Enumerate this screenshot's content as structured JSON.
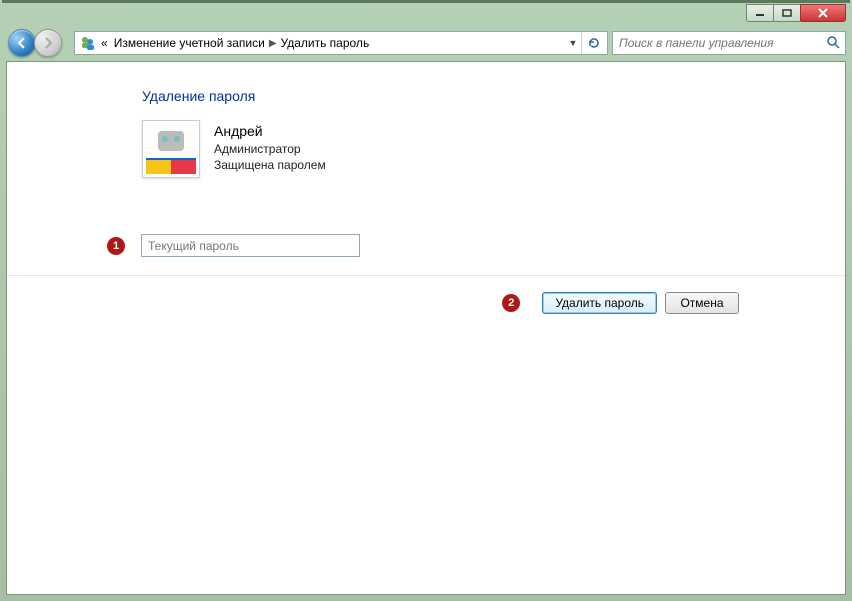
{
  "breadcrumb": {
    "prefix_icon": "users-icon",
    "overflow": "«",
    "items": [
      "Изменение учетной записи",
      "Удалить пароль"
    ]
  },
  "search": {
    "placeholder": "Поиск в панели управления"
  },
  "page": {
    "heading": "Удаление пароля"
  },
  "user": {
    "name": "Андрей",
    "role": "Администратор",
    "protection": "Защищена паролем"
  },
  "form": {
    "current_password_placeholder": "Текущий пароль"
  },
  "actions": {
    "primary": "Удалить пароль",
    "cancel": "Отмена"
  },
  "markers": {
    "one": "1",
    "two": "2"
  }
}
